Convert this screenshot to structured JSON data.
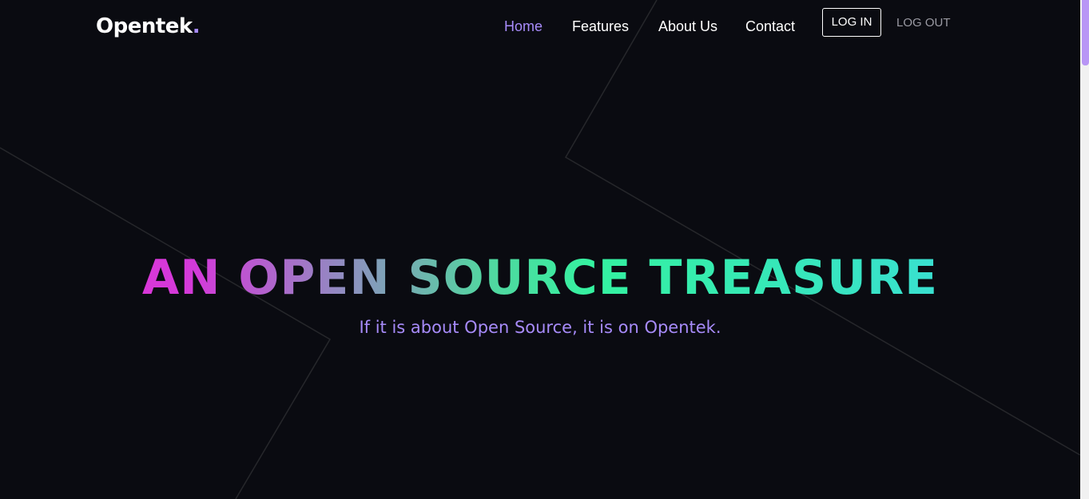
{
  "header": {
    "logo_text": "Opentek",
    "logo_dot": ".",
    "nav": [
      {
        "label": "Home",
        "active": true
      },
      {
        "label": "Features",
        "active": false
      },
      {
        "label": "About Us",
        "active": false
      },
      {
        "label": "Contact",
        "active": false
      }
    ],
    "login_label": "LOG IN",
    "logout_label": "LOG OUT"
  },
  "hero": {
    "title": "AN OPEN SOURCE TREASURE",
    "subtitle": "If it is about Open Source, it is on Opentek."
  },
  "colors": {
    "background": "#0a0b11",
    "accent": "#a78bfa",
    "gradient_start": "#e82fd7",
    "gradient_mid": "#34f2a0",
    "gradient_end": "#3cd9e6"
  }
}
